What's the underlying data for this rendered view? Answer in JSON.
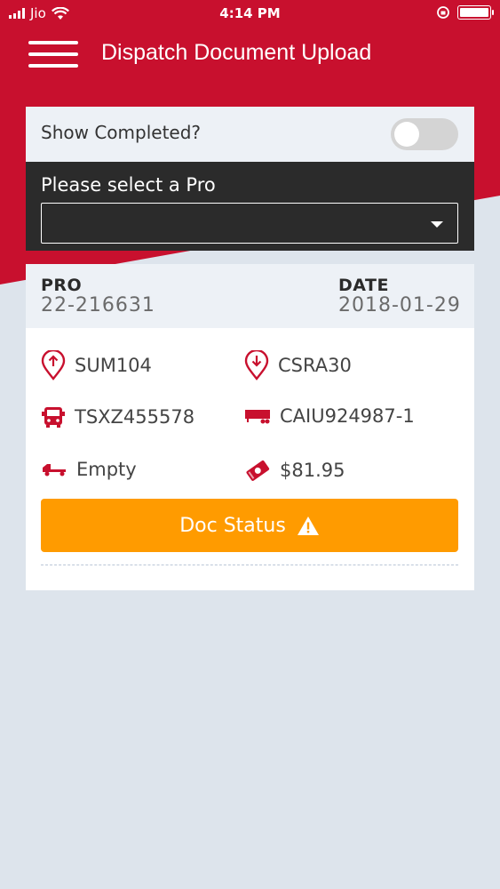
{
  "status_bar": {
    "carrier": "Jio",
    "time": "4:14 PM"
  },
  "header": {
    "title": "Dispatch Document Upload"
  },
  "filter": {
    "show_completed_label": "Show Completed?",
    "show_completed_value": false,
    "select_label": "Please select a Pro",
    "select_value": ""
  },
  "pro": {
    "pro_label": "PRO",
    "pro_value": "22-216631",
    "date_label": "DATE",
    "date_value": "2018-01-29",
    "origin": "SUM104",
    "destination": "CSRA30",
    "truck": "TSXZ455578",
    "container": "CAIU924987-1",
    "load_status": "Empty",
    "amount": "$81.95",
    "doc_status_label": "Doc Status"
  },
  "colors": {
    "brand_red": "#c8102e",
    "accent_orange": "#ff9b00",
    "background": "#dde4ec"
  },
  "icons": {
    "origin": "pickup-pin-icon",
    "destination": "dropoff-pin-icon",
    "truck": "truck-front-icon",
    "container": "trailer-icon",
    "load": "flatbed-truck-icon",
    "amount": "money-tag-icon",
    "warning": "warning-icon"
  }
}
